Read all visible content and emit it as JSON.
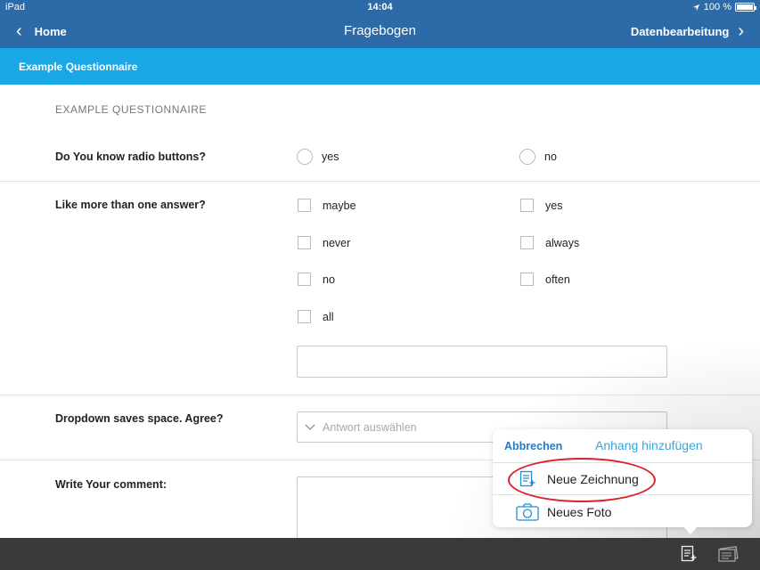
{
  "status_bar": {
    "device": "iPad",
    "time": "14:04",
    "battery": "100 %",
    "battery_level": 1.0
  },
  "nav": {
    "back_label": "Home",
    "title": "Fragebogen",
    "forward_label": "Datenbearbeitung"
  },
  "section_header": "Example Questionnaire",
  "questionnaire_title": "EXAMPLE QUESTIONNAIRE",
  "questions": {
    "radio": {
      "label": "Do You know radio buttons?",
      "options": [
        "yes",
        "no"
      ]
    },
    "checkbox": {
      "label": "Like more than one answer?",
      "options": [
        "maybe",
        "yes",
        "never",
        "always",
        "no",
        "often",
        "all"
      ]
    },
    "dropdown": {
      "label": "Dropdown saves space. Agree?",
      "placeholder": "Antwort auswählen"
    },
    "comment": {
      "label": "Write Your comment:"
    }
  },
  "popover": {
    "cancel_label": "Abbrechen",
    "title": "Anhang hinzufügen",
    "items": [
      "Neue Zeichnung",
      "Neues Foto"
    ]
  },
  "colors": {
    "nav_bar": "#2c6aa8",
    "section_header": "#1aa7e6",
    "toolbar": "#3a3a3a",
    "highlight": "#d8222a"
  },
  "icons": {
    "back": "chevron-left-icon",
    "forward": "chevron-right-icon",
    "location": "location-arrow-icon",
    "drawing": "new-drawing-icon",
    "photo": "camera-icon",
    "attachment": "attachment-icon",
    "cards": "cards-icon"
  }
}
